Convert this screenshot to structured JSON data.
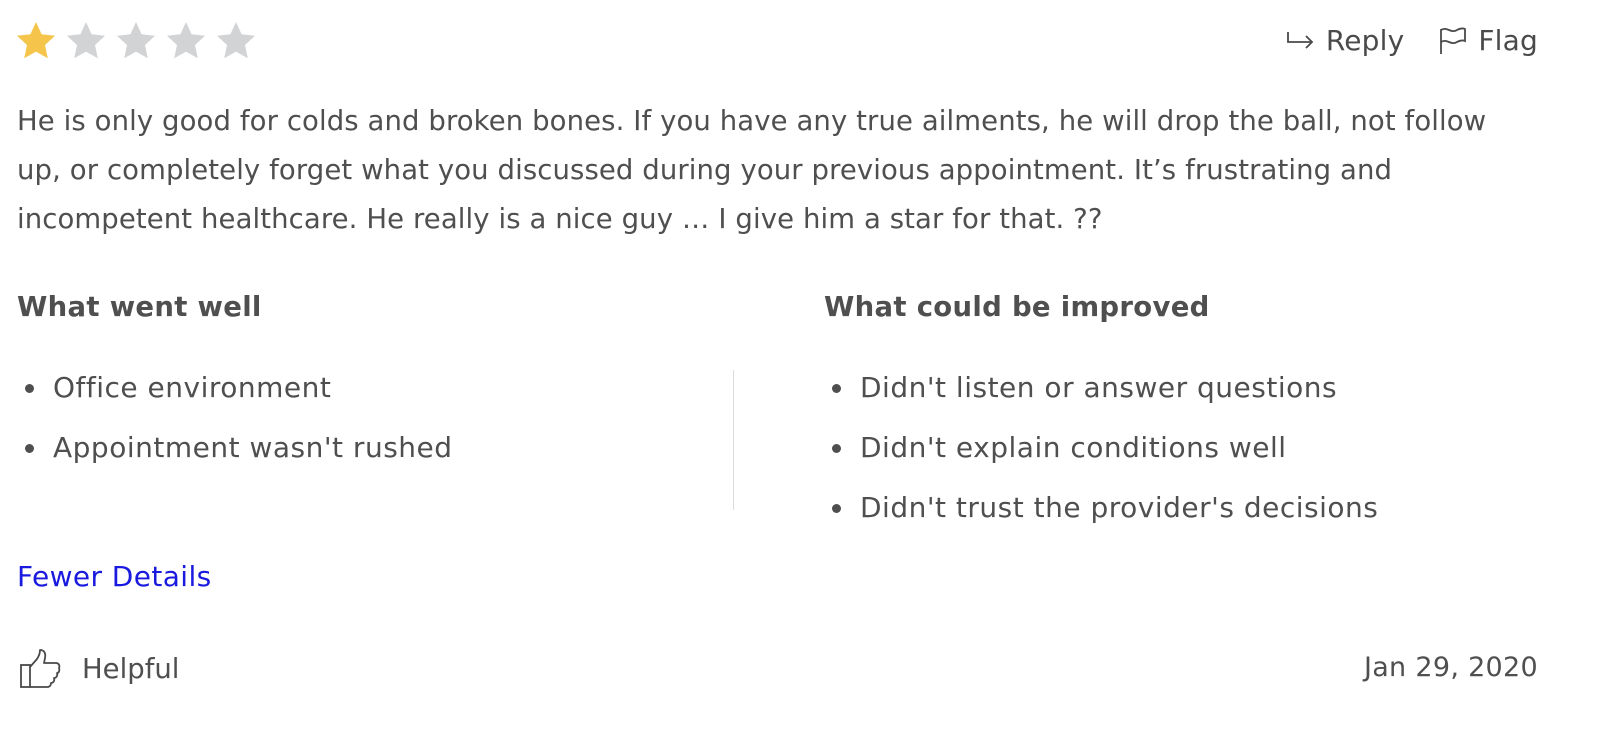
{
  "rating": {
    "value": 1,
    "max": 5,
    "filled_color": "#f4c54a",
    "empty_color": "#d2d3d5",
    "icon": "star-icon"
  },
  "actions": {
    "reply_label": "Reply",
    "reply_icon": "reply-arrow-icon",
    "flag_label": "Flag",
    "flag_icon": "flag-icon"
  },
  "review_text": "He is only good for colds and broken bones. If you have any true ailments, he will drop the ball, not follow up, or completely forget what you discussed during your previous appointment. It’s frustrating and incompetent healthcare. He really is a nice guy … I give him a star for that. ??",
  "went_well": {
    "title": "What went well",
    "items": [
      "Office environment",
      "Appointment wasn't rushed"
    ]
  },
  "improve": {
    "title": "What could be improved",
    "items": [
      "Didn't listen or answer questions",
      "Didn't explain conditions well",
      "Didn't trust the provider's decisions"
    ]
  },
  "fewer_details_label": "Fewer Details",
  "link_color": "#1a1adf",
  "helpful": {
    "label": "Helpful",
    "icon": "thumbs-up-icon"
  },
  "date": "Jan 29, 2020"
}
